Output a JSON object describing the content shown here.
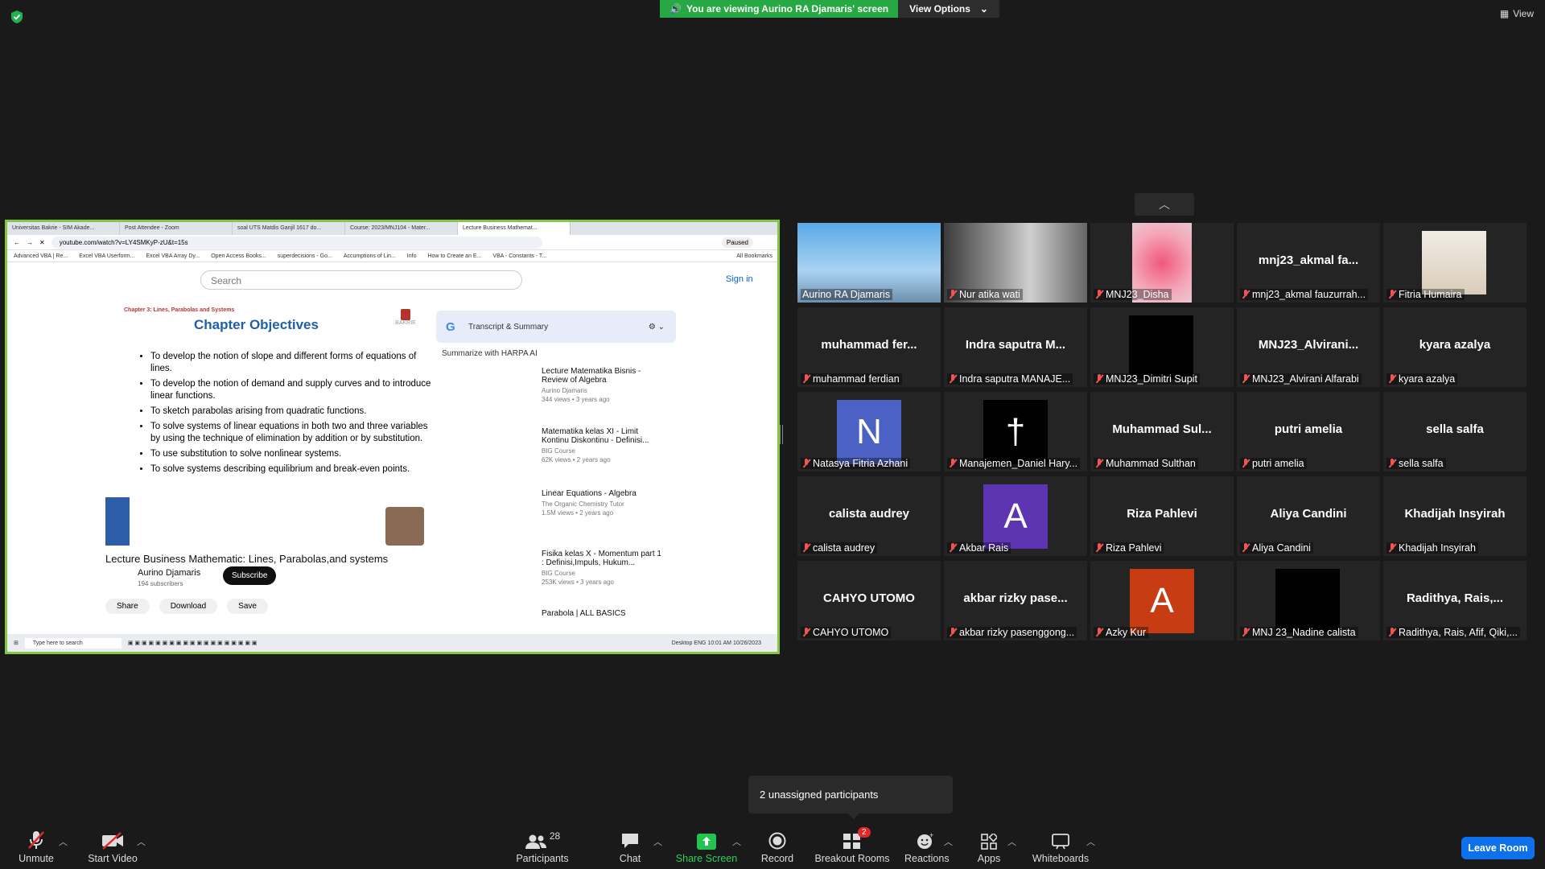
{
  "banner": {
    "viewing_text": "You are viewing Aurino RA Djamaris' screen",
    "view_options": "View Options"
  },
  "top_right_view": "View",
  "shared_screen": {
    "tabs": [
      "Universitas Bakrie - SIM Akade...",
      "Post Attendee - Zoom",
      "soal UTS Matdis Ganjil 1617 do...",
      "Course: 2023/MNJ104 - Mater...",
      "Lecture Business Mathemat..."
    ],
    "url": "youtube.com/watch?v=LY4SMKyP-zU&t=15s",
    "paused": "Paused",
    "bookmarks": [
      "Advanced VBA | Re...",
      "Excel VBA Userform...",
      "Excel VBA Array Dy...",
      "Open Access Books...",
      "superdecisions - Go...",
      "Accumptions of Lin...",
      "Info",
      "How to Create an E...",
      "VBA - Constants - T...",
      "All Bookmarks"
    ],
    "search_placeholder": "Search",
    "sign_in": "Sign in",
    "slide": {
      "kicker": "Chapter 3: Lines, Parabolas and Systems",
      "title": "Chapter Objectives",
      "logo": "BAKRIE",
      "objectives": [
        "To develop the notion of slope and different forms of equations of lines.",
        "To develop the notion of demand and supply curves and to introduce linear functions.",
        "To sketch parabolas arising from quadratic functions.",
        "To solve systems of linear equations in both two and three variables by using the technique of elimination by addition or by substitution.",
        "To use substitution to solve nonlinear systems.",
        "To solve systems describing equilibrium and break-even points."
      ]
    },
    "video_title": "Lecture Business Mathematic: Lines, Parabolas,and systems",
    "channel": "Aurino Djamaris",
    "subscribers": "194 subscribers",
    "subscribe": "Subscribe",
    "actions": [
      "Share",
      "Download",
      "Save"
    ],
    "extension": {
      "title": "Transcript & Summary",
      "summarize": "Summarize with HARPA AI"
    },
    "recommendations": [
      {
        "title": "Lecture Matematika Bisnis - Review of Algebra",
        "channel": "Aurino Djamaris",
        "meta": "344 views • 3 years ago"
      },
      {
        "title": "Matematika kelas XI - Limit Kontinu Diskontinu - Definisi...",
        "channel": "BIG Course",
        "meta": "62K views • 2 years ago"
      },
      {
        "title": "Linear Equations - Algebra",
        "channel": "The Organic Chemistry Tutor",
        "meta": "1.5M views • 2 years ago"
      },
      {
        "title": "Fisika kelas X - Momentum part 1 : Definisi,Impuls, Hukum...",
        "channel": "BIG Course",
        "meta": "253K views • 3 years ago"
      },
      {
        "title": "Parabola | ALL BASICS",
        "channel": "",
        "meta": ""
      }
    ],
    "taskbar": {
      "search": "Type here to search",
      "desktop": "Desktop",
      "lang": "ENG",
      "time": "10:01 AM",
      "date": "10/26/2023"
    }
  },
  "participants": [
    {
      "name": "Aurino RA Djamaris",
      "big": "",
      "type": "photo",
      "active": true,
      "muted": false
    },
    {
      "name": "Nur atika wati",
      "big": "",
      "type": "photo",
      "active": false,
      "muted": true
    },
    {
      "name": "MNJ23_Disha",
      "big": "",
      "type": "photo",
      "active": false,
      "muted": true
    },
    {
      "name": "mnj23_akmal fauzurrah...",
      "big": "mnj23_akmal fa...",
      "type": "text",
      "muted": true
    },
    {
      "name": "Fitria Humaira",
      "big": "",
      "type": "photo",
      "muted": true
    },
    {
      "name": "muhammad ferdian",
      "big": "muhammad fer...",
      "type": "text",
      "muted": true
    },
    {
      "name": "Indra saputra MANAJE...",
      "big": "Indra saputra M...",
      "type": "text",
      "muted": true
    },
    {
      "name": "MNJ23_Dimitri Supit",
      "big": "",
      "type": "black",
      "muted": true
    },
    {
      "name": "MNJ23_Alvirani Alfarabi",
      "big": "MNJ23_Alvirani...",
      "type": "text",
      "muted": true
    },
    {
      "name": "kyara azalya",
      "big": "kyara azalya",
      "type": "text",
      "muted": true
    },
    {
      "name": "Natasya Fitria Azhani",
      "big": "N",
      "type": "avatar",
      "color": "#4b62c4",
      "muted": true
    },
    {
      "name": "Manajemen_Daniel Hary...",
      "big": "†",
      "type": "avatar",
      "color": "#000000",
      "muted": true
    },
    {
      "name": "Muhammad Sulthan",
      "big": "Muhammad Sul...",
      "type": "text",
      "muted": true
    },
    {
      "name": "putri amelia",
      "big": "putri amelia",
      "type": "text",
      "muted": true
    },
    {
      "name": "sella salfa",
      "big": "sella salfa",
      "type": "text",
      "muted": true
    },
    {
      "name": "calista audrey",
      "big": "calista audrey",
      "type": "text",
      "muted": true
    },
    {
      "name": "Akbar Rais",
      "big": "A",
      "type": "avatar",
      "color": "#5d35b3",
      "muted": true
    },
    {
      "name": "Riza Pahlevi",
      "big": "Riza Pahlevi",
      "type": "text",
      "muted": true
    },
    {
      "name": "Aliya Candini",
      "big": "Aliya Candini",
      "type": "text",
      "muted": true
    },
    {
      "name": "Khadijah Insyirah",
      "big": "Khadijah Insyirah",
      "type": "text",
      "muted": true
    },
    {
      "name": "CAHYO UTOMO",
      "big": "CAHYO UTOMO",
      "type": "text",
      "muted": true
    },
    {
      "name": "akbar rizky pasenggong...",
      "big": "akbar rizky pase...",
      "type": "text",
      "muted": true
    },
    {
      "name": "Azky Kur",
      "big": "A",
      "type": "avatar",
      "color": "#c83c14",
      "muted": true
    },
    {
      "name": "MNJ 23_Nadine calista",
      "big": "",
      "type": "black",
      "muted": true
    },
    {
      "name": "Radithya, Rais, Afif, Qiki,...",
      "big": "Radithya, Rais,...",
      "type": "text",
      "muted": true
    }
  ],
  "tooltip": "2 unassigned participants",
  "toolbar": {
    "unmute": "Unmute",
    "start_video": "Start Video",
    "participants": "Participants",
    "participants_count": "28",
    "chat": "Chat",
    "share_screen": "Share Screen",
    "record": "Record",
    "breakout_rooms": "Breakout Rooms",
    "breakout_badge": "2",
    "reactions": "Reactions",
    "apps": "Apps",
    "whiteboards": "Whiteboards",
    "leave": "Leave Room"
  },
  "colors": {
    "share_border": "#85c741",
    "banner_green": "#26a942",
    "active_speaker": "#f5df4d",
    "leave_blue": "#0e71eb"
  }
}
